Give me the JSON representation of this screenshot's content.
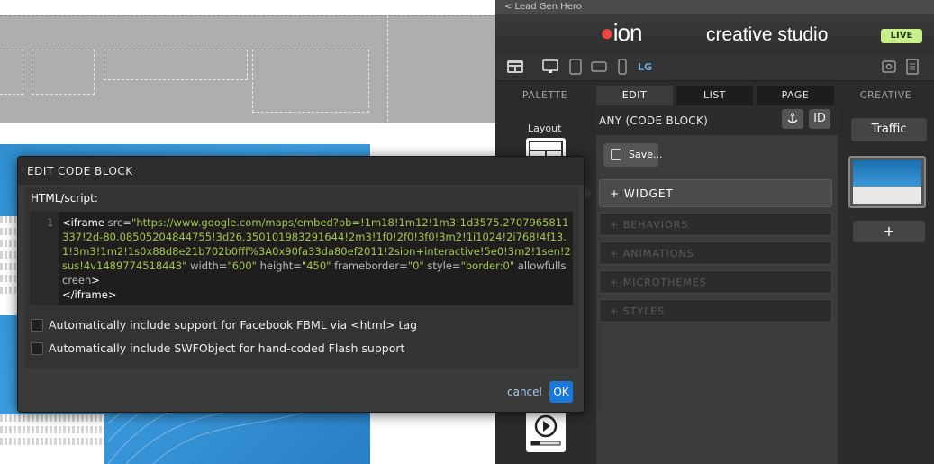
{
  "breadcrumb": {
    "label": "< Lead Gen Hero"
  },
  "brand": {
    "logo": "ion",
    "title": "creative studio",
    "live_badge": "LIVE"
  },
  "devices": {
    "size_label": "LG",
    "icons": [
      "layout-icon",
      "desktop-icon",
      "tablet-icon",
      "tablet-landscape-icon",
      "phone-icon",
      "preview-icon",
      "document-icon"
    ]
  },
  "tabs": {
    "palette": "PALETTE",
    "edit": "EDIT",
    "list": "LIST",
    "page": "PAGE",
    "creative": "CREATIVE",
    "active": "EDIT"
  },
  "palette": {
    "layout_label": "Layout"
  },
  "edit": {
    "heading": "ANY (CODE BLOCK)",
    "id_button": "ID",
    "save_label": "Save...",
    "sections": {
      "widget": "+ WIDGET",
      "behaviors": "+ BEHAVIORS",
      "animations": "+ ANIMATIONS",
      "microthemes": "+ MICROTHEMES",
      "styles": "+ STYLES"
    }
  },
  "creative": {
    "traffic_label": "Traffic",
    "add_label": "+"
  },
  "modal": {
    "title": "EDIT CODE BLOCK",
    "field_label": "HTML/script:",
    "line_number": "1",
    "code": {
      "tag_open": "<iframe",
      "src_attr": "src=",
      "src_value": "\"https://www.google.com/maps/embed?pb=!1m18!1m12!1m3!1d3575.2707965811337!2d-80.08505204844755!3d26.350101983291644!2m3!1f0!2f0!3f0!3m2!1i1024!2i768!4f13.1!3m3!1m2!1s0x88d8e21b702b0fff%3A0x90fa33da80ef2011!2sion+interactive!5e0!3m2!1sen!2sus!4v1489774518443\"",
      "width_attr": "width=",
      "width_value": "\"600\"",
      "height_attr": "height=",
      "height_value": "\"450\"",
      "frameborder_attr": "frameborder=",
      "frameborder_value": "\"0\"",
      "style_attr": "style=",
      "style_value": "\"border:0\"",
      "allow_attr": "allowfullscreen",
      "tag_end": ">",
      "tag_close": "</iframe>"
    },
    "options": {
      "fbml": "Automatically include support for Facebook FBML via <html> tag",
      "swf": "Automatically include SWFObject for hand-coded Flash support"
    },
    "cancel_label": "cancel",
    "ok_label": "OK"
  },
  "colors": {
    "accent": "#1a79d8",
    "live": "#c7f08c",
    "code_value": "#a6c54a",
    "panel": "#2b2b2b"
  }
}
